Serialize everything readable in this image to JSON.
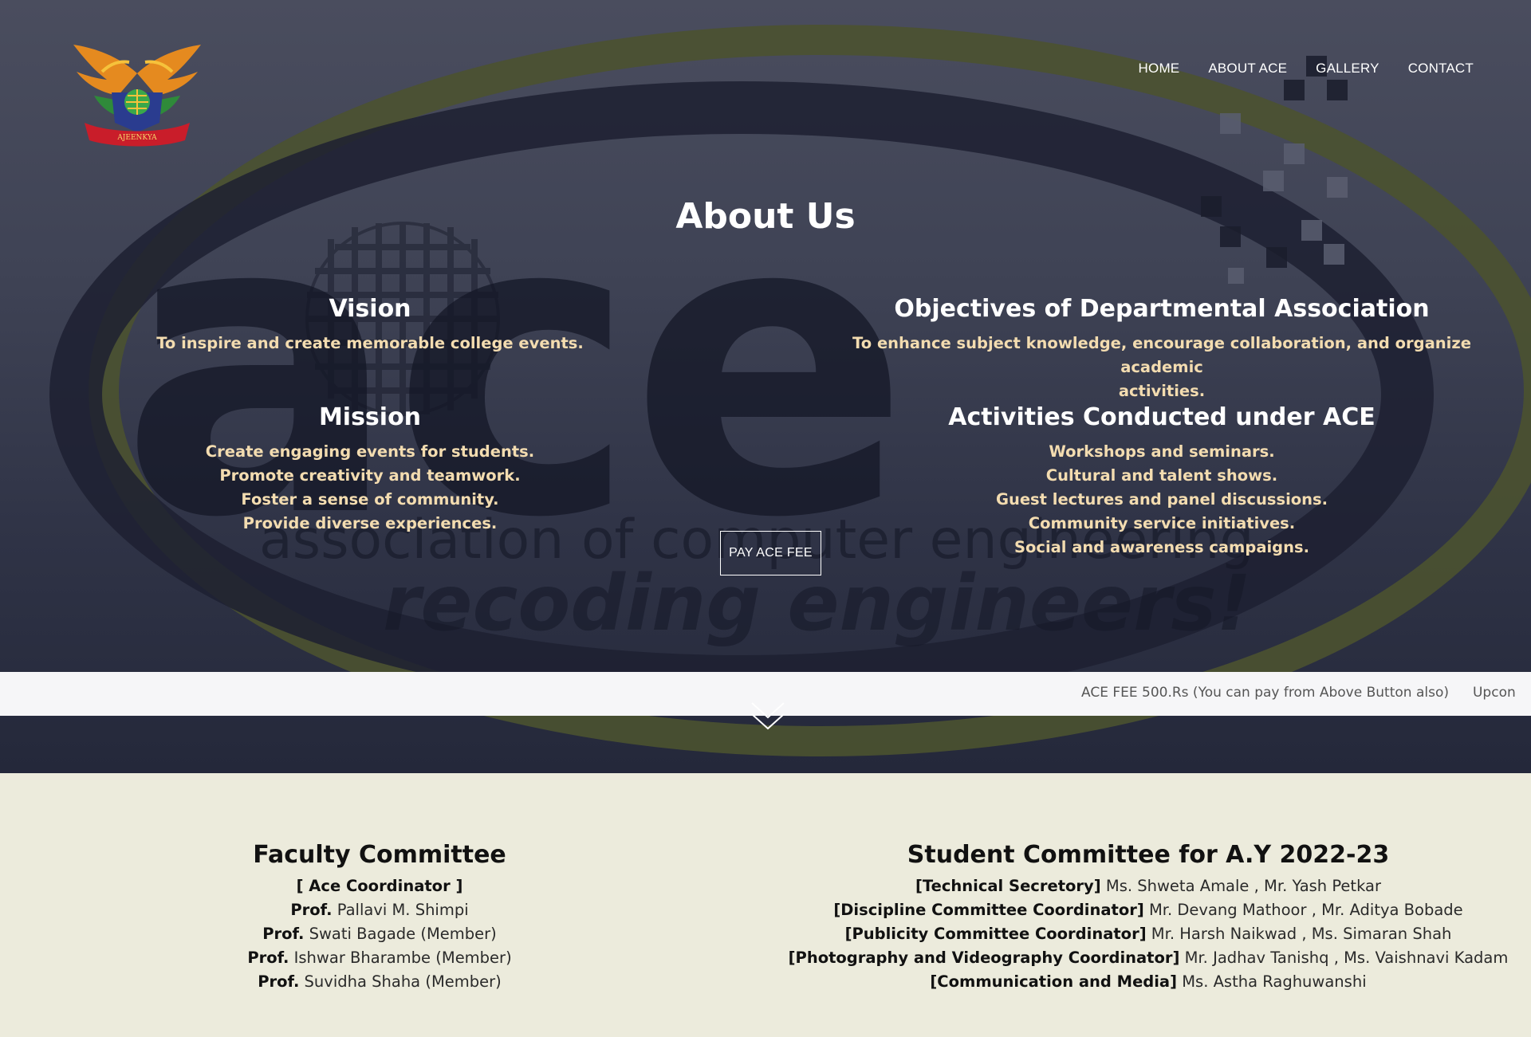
{
  "brand": {
    "logo_text": "AJEENKYA"
  },
  "nav": {
    "items": [
      {
        "label": "HOME"
      },
      {
        "label": "ABOUT ACE"
      },
      {
        "label": "GALLERY"
      },
      {
        "label": "CONTACT"
      }
    ]
  },
  "hero": {
    "background_text": {
      "big": "ace",
      "line1": "association of computer engineering",
      "line2": "recoding engineers!"
    },
    "title": "About Us",
    "vision": {
      "heading": "Vision",
      "lines": [
        "To inspire and create memorable college events."
      ]
    },
    "mission": {
      "heading": "Mission",
      "lines": [
        "Create engaging events for students.",
        "Promote creativity and teamwork.",
        "Foster a sense of community.",
        "Provide diverse experiences."
      ]
    },
    "objectives": {
      "heading": "Objectives of Departmental Association",
      "lines": [
        "To enhance subject knowledge, encourage collaboration, and organize academic",
        "activities."
      ]
    },
    "activities": {
      "heading": "Activities Conducted under ACE",
      "lines": [
        "Workshops and seminars.",
        "Cultural and talent shows.",
        "Guest lectures and panel discussions.",
        "Community service initiatives.",
        "Social and awareness campaigns."
      ]
    },
    "pay_button": "PAY ACE FEE"
  },
  "ticker": {
    "items": [
      "ACE FEE 500.Rs (You can pay from Above Button also)",
      "Upcon"
    ]
  },
  "faculty": {
    "heading": "Faculty Committee",
    "rows": [
      {
        "role": "[ Ace Coordinator ]",
        "name": ""
      },
      {
        "role": "Prof.",
        "name": " Pallavi M. Shimpi"
      },
      {
        "role": "Prof.",
        "name": " Swati Bagade (Member)"
      },
      {
        "role": "Prof.",
        "name": " Ishwar Bharambe (Member)"
      },
      {
        "role": "Prof.",
        "name": " Suvidha Shaha (Member)"
      }
    ]
  },
  "students": {
    "heading": "Student Committee for A.Y 2022-23",
    "rows": [
      {
        "role": "[Technical Secretory]",
        "name": " Ms. Shweta Amale , Mr. Yash Petkar"
      },
      {
        "role": "[Discipline Committee Coordinator]",
        "name": " Mr. Devang Mathoor , Mr. Aditya Bobade"
      },
      {
        "role": "[Publicity Committee Coordinator]",
        "name": " Mr. Harsh Naikwad , Ms. Simaran Shah"
      },
      {
        "role": "[Photography and Videography Coordinator]",
        "name": " Mr. Jadhav Tanishq , Ms. Vaishnavi Kadam"
      },
      {
        "role": "[Communication and Media]",
        "name": " Ms. Astha Raghuwanshi"
      }
    ]
  },
  "colors": {
    "hero_top": "#4a4d5e",
    "hero_bottom": "#24283a",
    "accent_text": "#f3dcb0",
    "olive_ring": "#4b5230",
    "cream_bg": "#ecebdc"
  }
}
